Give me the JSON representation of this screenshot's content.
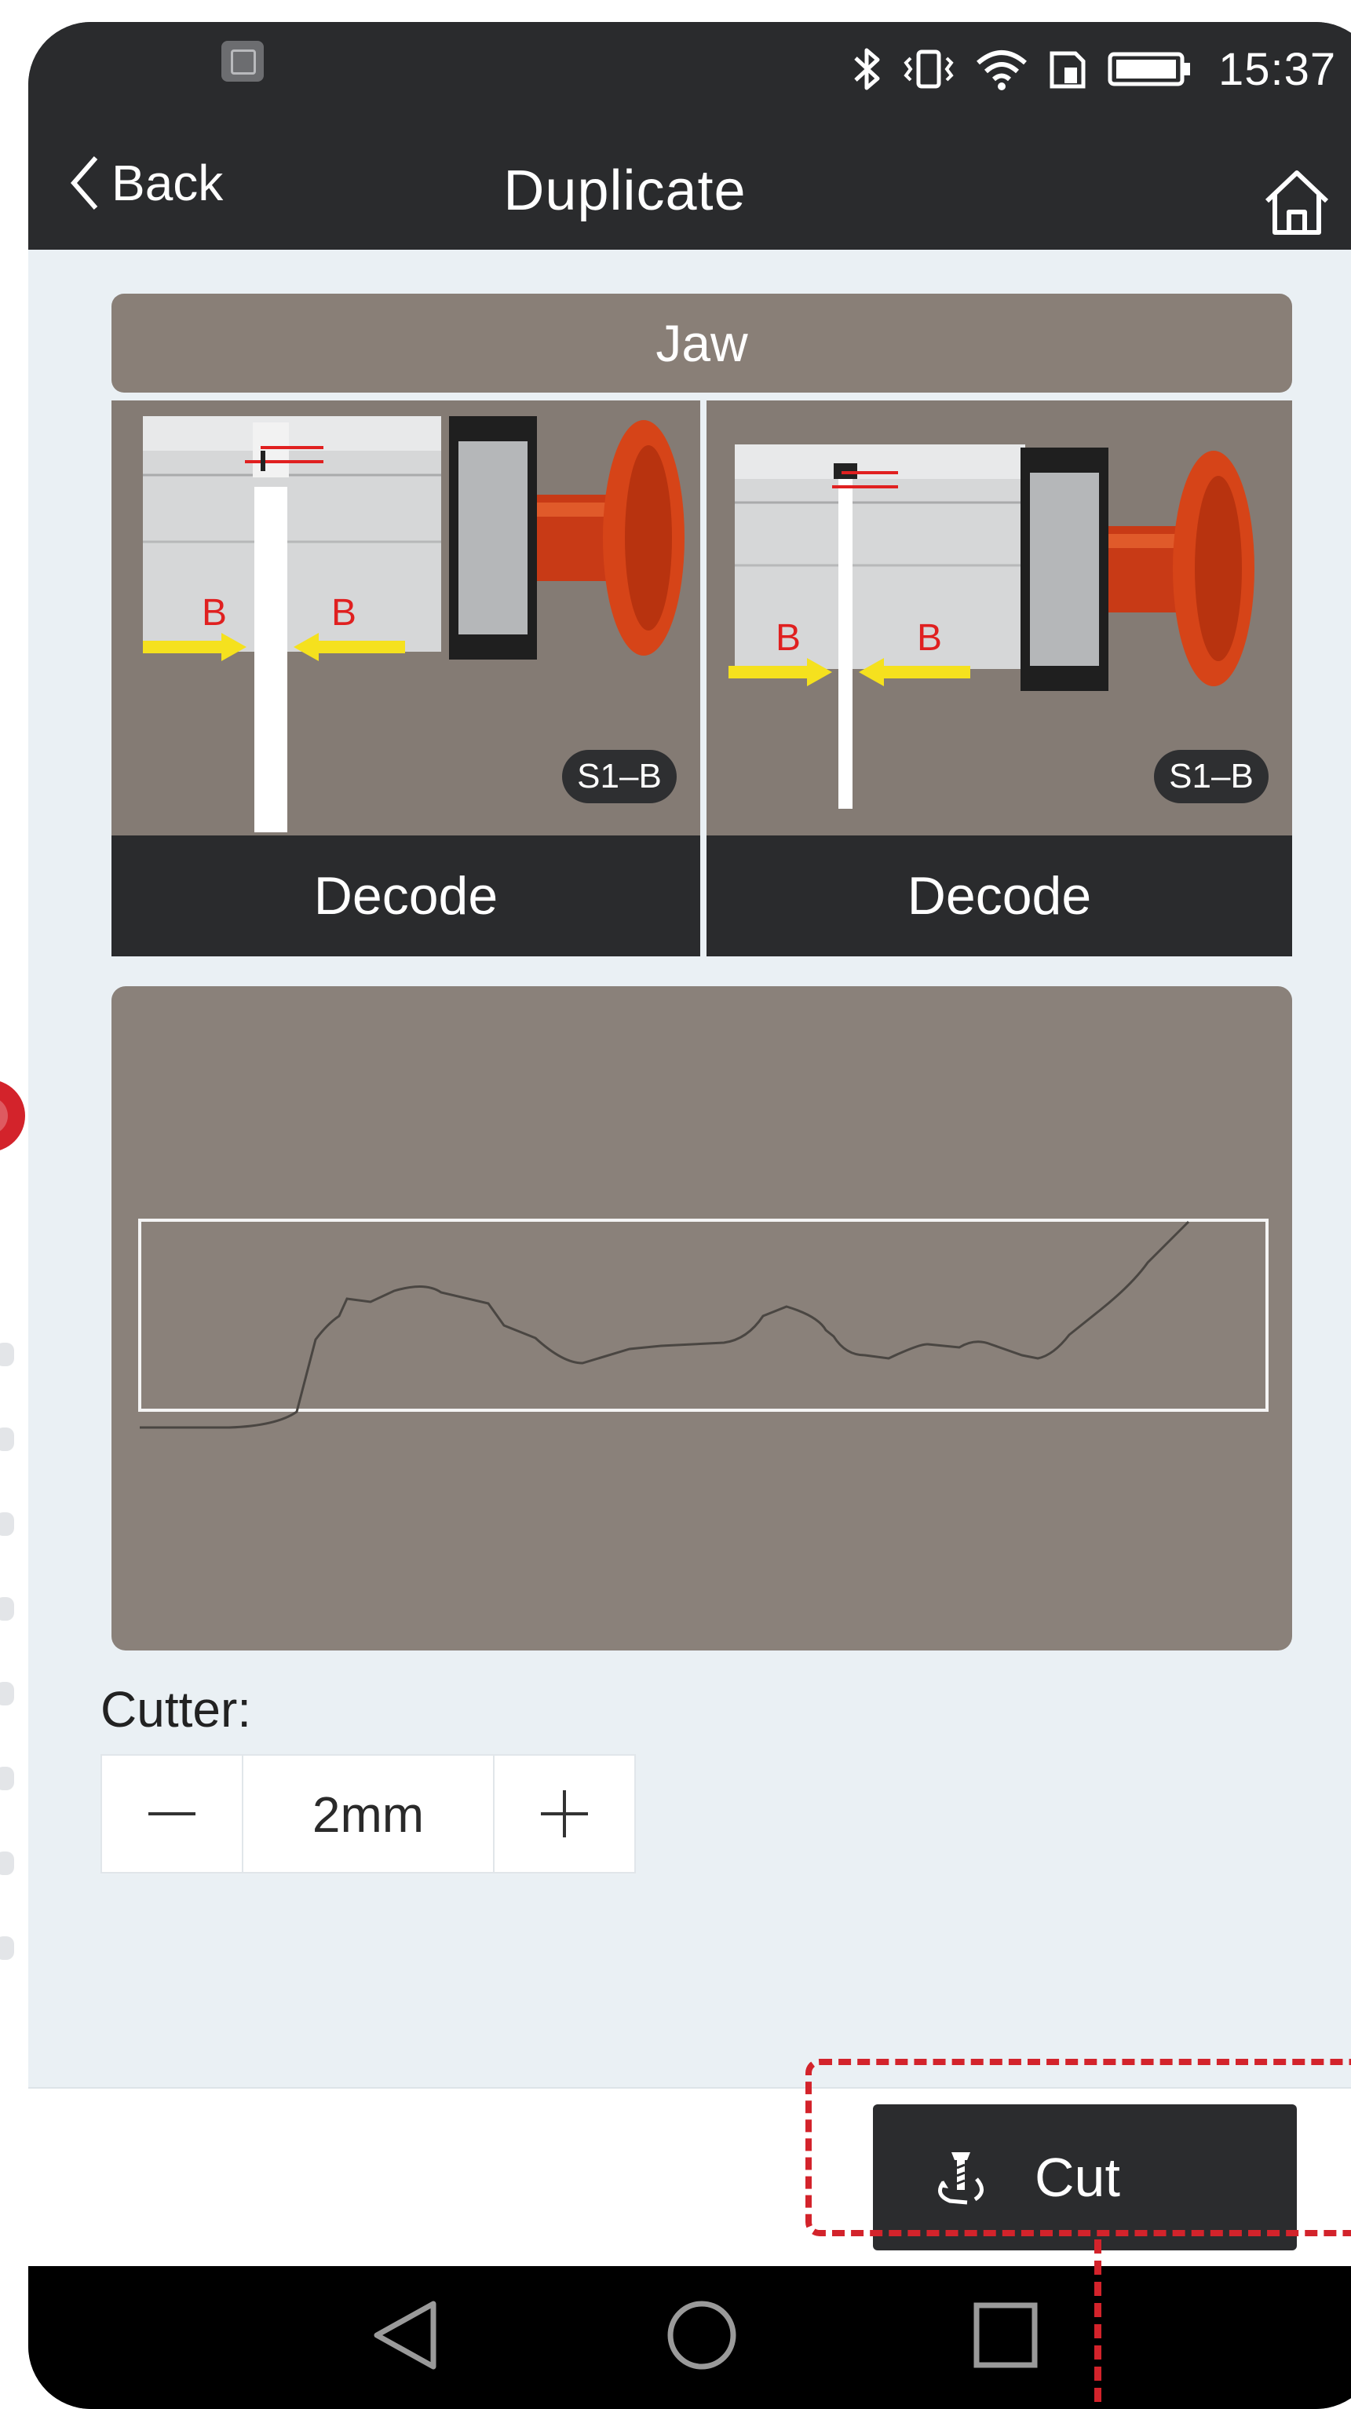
{
  "status_bar": {
    "time": "15:37",
    "icons": [
      "gallery-icon",
      "bluetooth-icon",
      "vibrate-icon",
      "wifi-icon",
      "sim-icon",
      "battery-icon"
    ]
  },
  "nav": {
    "back_label": "Back",
    "title": "Duplicate",
    "home_icon": "home-icon"
  },
  "jaw": {
    "title": "Jaw",
    "panels": [
      {
        "badge": "S1–B",
        "decode_label": "Decode",
        "side_labels": [
          "B",
          "B"
        ]
      },
      {
        "badge": "S1–B",
        "decode_label": "Decode",
        "side_labels": [
          "B",
          "B"
        ]
      }
    ]
  },
  "cutter": {
    "label": "Cutter:",
    "value": "2mm",
    "decrement_icon": "minus-icon",
    "increment_icon": "plus-icon"
  },
  "actions": {
    "cut_label": "Cut",
    "cut_icon": "cutter-drill-icon"
  },
  "system_nav": [
    "back-triangle-icon",
    "home-circle-icon",
    "recents-square-icon"
  ],
  "colors": {
    "dark_bar": "#2a2b2d",
    "panel_gray": "#897f77",
    "content_bg": "#eaf0f4",
    "highlight_red": "#d3232b"
  }
}
